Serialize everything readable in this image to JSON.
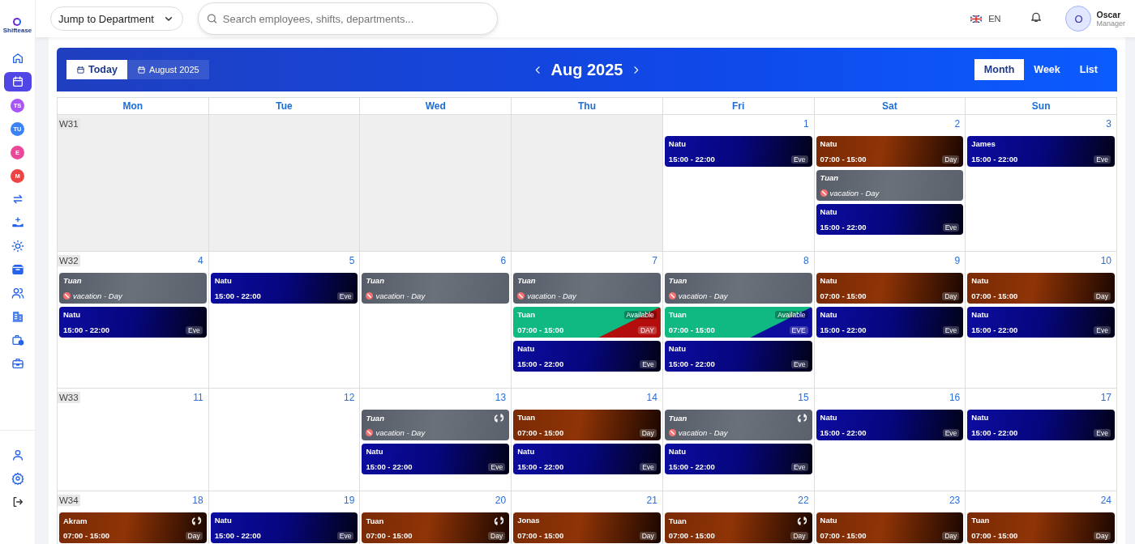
{
  "sidebar": {
    "logo": "Shiftease",
    "items": [
      {
        "kind": "home",
        "selected": false
      },
      {
        "kind": "calendar",
        "selected": true
      },
      {
        "kind": "avatar",
        "label": "TS",
        "color": "#a855f7",
        "selected": false
      },
      {
        "kind": "avatar",
        "label": "TU",
        "color": "#3b82f6",
        "selected": false
      },
      {
        "kind": "avatar",
        "label": "E",
        "color": "#ec4899",
        "selected": false
      },
      {
        "kind": "avatar",
        "label": "M",
        "color": "#ef4444",
        "selected": false
      },
      {
        "kind": "swap",
        "selected": false
      },
      {
        "kind": "hand",
        "selected": false
      },
      {
        "kind": "sun",
        "selected": false
      },
      {
        "kind": "box",
        "selected": false
      },
      {
        "kind": "users",
        "selected": false
      },
      {
        "kind": "building",
        "selected": false
      },
      {
        "kind": "briefcase-clock",
        "selected": false
      },
      {
        "kind": "toolbox",
        "selected": false
      }
    ],
    "bottom_items": [
      {
        "kind": "user"
      },
      {
        "kind": "gear"
      },
      {
        "kind": "logout"
      }
    ]
  },
  "topbar": {
    "department_select": "Jump to Department",
    "search": {
      "placeholder": "Search employees, shifts, departments..."
    },
    "language": "EN",
    "user": {
      "initial": "O",
      "name": "Oscar",
      "role": "Manager"
    }
  },
  "calendar": {
    "nav_buttons": [
      {
        "label": "Today",
        "selected": true
      },
      {
        "label": "August 2025",
        "selected": false
      }
    ],
    "title": "Aug 2025",
    "views": [
      {
        "label": "Month",
        "selected": true
      },
      {
        "label": "Week",
        "selected": false
      },
      {
        "label": "List",
        "selected": false
      }
    ],
    "weekdays": [
      "Mon",
      "Tue",
      "Wed",
      "Thu",
      "Fri",
      "Sat",
      "Sun"
    ],
    "weeks": [
      {
        "label": "W31",
        "days": [
          {
            "outside": true
          },
          {
            "outside": true
          },
          {
            "outside": true
          },
          {
            "outside": true
          },
          {
            "outside": false,
            "date": "1",
            "events": [
              {
                "kind": "eve",
                "name": "Natu",
                "time": "15:00 - 22:00",
                "badge": "Eve"
              }
            ]
          },
          {
            "outside": false,
            "date": "2",
            "events": [
              {
                "kind": "day",
                "name": "Natu",
                "time": "07:00 - 15:00",
                "badge": "Day"
              },
              {
                "kind": "vacation",
                "name": "Tuan",
                "note": "vacation - Day"
              },
              {
                "kind": "eve",
                "name": "Natu",
                "time": "15:00 - 22:00",
                "badge": "Eve"
              }
            ]
          },
          {
            "outside": false,
            "date": "3",
            "events": [
              {
                "kind": "eve",
                "name": "James",
                "time": "15:00 - 22:00",
                "badge": "Eve"
              }
            ]
          }
        ]
      },
      {
        "label": "W32",
        "days": [
          {
            "outside": false,
            "date": "4",
            "events": [
              {
                "kind": "vacation",
                "name": "Tuan",
                "note": "vacation - Day"
              },
              {
                "kind": "eve",
                "name": "Natu",
                "time": "15:00 - 22:00",
                "badge": "Eve"
              }
            ]
          },
          {
            "outside": false,
            "date": "5",
            "events": [
              {
                "kind": "eve",
                "name": "Natu",
                "time": "15:00 - 22:00",
                "badge": "Eve"
              }
            ]
          },
          {
            "outside": false,
            "date": "6",
            "events": [
              {
                "kind": "vacation",
                "name": "Tuan",
                "note": "vacation - Day"
              }
            ]
          },
          {
            "outside": false,
            "date": "7",
            "events": [
              {
                "kind": "vacation",
                "name": "Tuan",
                "note": "vacation - Day"
              },
              {
                "kind": "available",
                "color": "#b30d0d",
                "name": "Tuan",
                "time": "07:00 - 15:00",
                "tag": "Available",
                "badge": "DAY"
              },
              {
                "kind": "eve",
                "name": "Natu",
                "time": "15:00 - 22:00",
                "badge": "Eve"
              }
            ]
          },
          {
            "outside": false,
            "date": "8",
            "events": [
              {
                "kind": "vacation",
                "name": "Tuan",
                "note": "vacation - Day"
              },
              {
                "kind": "available",
                "color": "#0d0d9e",
                "name": "Tuan",
                "time": "07:00 - 15:00",
                "tag": "Available",
                "badge": "EVE"
              },
              {
                "kind": "eve",
                "name": "Natu",
                "time": "15:00 - 22:00",
                "badge": "Eve"
              }
            ]
          },
          {
            "outside": false,
            "date": "9",
            "events": [
              {
                "kind": "day",
                "name": "Natu",
                "time": "07:00 - 15:00",
                "badge": "Day"
              },
              {
                "kind": "eve",
                "name": "Natu",
                "time": "15:00 - 22:00",
                "badge": "Eve"
              }
            ]
          },
          {
            "outside": false,
            "date": "10",
            "events": [
              {
                "kind": "day",
                "name": "Natu",
                "time": "07:00 - 15:00",
                "badge": "Day"
              },
              {
                "kind": "eve",
                "name": "Natu",
                "time": "15:00 - 22:00",
                "badge": "Eve"
              }
            ]
          }
        ]
      },
      {
        "label": "W33",
        "days": [
          {
            "outside": false,
            "date": "11"
          },
          {
            "outside": false,
            "date": "12"
          },
          {
            "outside": false,
            "date": "13",
            "events": [
              {
                "kind": "vacation",
                "name": "Tuan",
                "note": "vacation - Day",
                "swap": true
              },
              {
                "kind": "eve",
                "name": "Natu",
                "time": "15:00 - 22:00",
                "badge": "Eve"
              }
            ]
          },
          {
            "outside": false,
            "date": "14",
            "events": [
              {
                "kind": "day",
                "name": "Tuan",
                "time": "07:00 - 15:00",
                "badge": "Day"
              },
              {
                "kind": "eve",
                "name": "Natu",
                "time": "15:00 - 22:00",
                "badge": "Eve"
              }
            ]
          },
          {
            "outside": false,
            "date": "15",
            "events": [
              {
                "kind": "vacation",
                "name": "Tuan",
                "note": "vacation - Day",
                "swap": true
              },
              {
                "kind": "eve",
                "name": "Natu",
                "time": "15:00 - 22:00",
                "badge": "Eve"
              }
            ]
          },
          {
            "outside": false,
            "date": "16",
            "events": [
              {
                "kind": "eve",
                "name": "Natu",
                "time": "15:00 - 22:00",
                "badge": "Eve"
              }
            ]
          },
          {
            "outside": false,
            "date": "17",
            "events": [
              {
                "kind": "eve",
                "name": "Natu",
                "time": "15:00 - 22:00",
                "badge": "Eve"
              }
            ]
          }
        ]
      },
      {
        "label": "W34",
        "days": [
          {
            "outside": false,
            "date": "18",
            "events": [
              {
                "kind": "day",
                "name": "Akram",
                "time": "07:00 - 15:00",
                "badge": "Day",
                "swap": true
              }
            ]
          },
          {
            "outside": false,
            "date": "19",
            "events": [
              {
                "kind": "eve",
                "name": "Natu",
                "time": "15:00 - 22:00",
                "badge": "Eve"
              }
            ]
          },
          {
            "outside": false,
            "date": "20",
            "events": [
              {
                "kind": "day",
                "name": "Tuan",
                "time": "07:00 - 15:00",
                "badge": "Day",
                "swap": true
              }
            ]
          },
          {
            "outside": false,
            "date": "21",
            "events": [
              {
                "kind": "day",
                "name": "Jonas",
                "time": "07:00 - 15:00",
                "badge": "Day"
              }
            ]
          },
          {
            "outside": false,
            "date": "22",
            "events": [
              {
                "kind": "day",
                "name": "Tuan",
                "time": "07:00 - 15:00",
                "badge": "Day",
                "swap": true
              }
            ]
          },
          {
            "outside": false,
            "date": "23",
            "events": [
              {
                "kind": "day",
                "name": "Natu",
                "time": "07:00 - 15:00",
                "badge": "Day"
              }
            ]
          },
          {
            "outside": false,
            "date": "24",
            "events": [
              {
                "kind": "day",
                "name": "Tuan",
                "time": "07:00 - 15:00",
                "badge": "Day"
              }
            ]
          }
        ]
      }
    ]
  }
}
